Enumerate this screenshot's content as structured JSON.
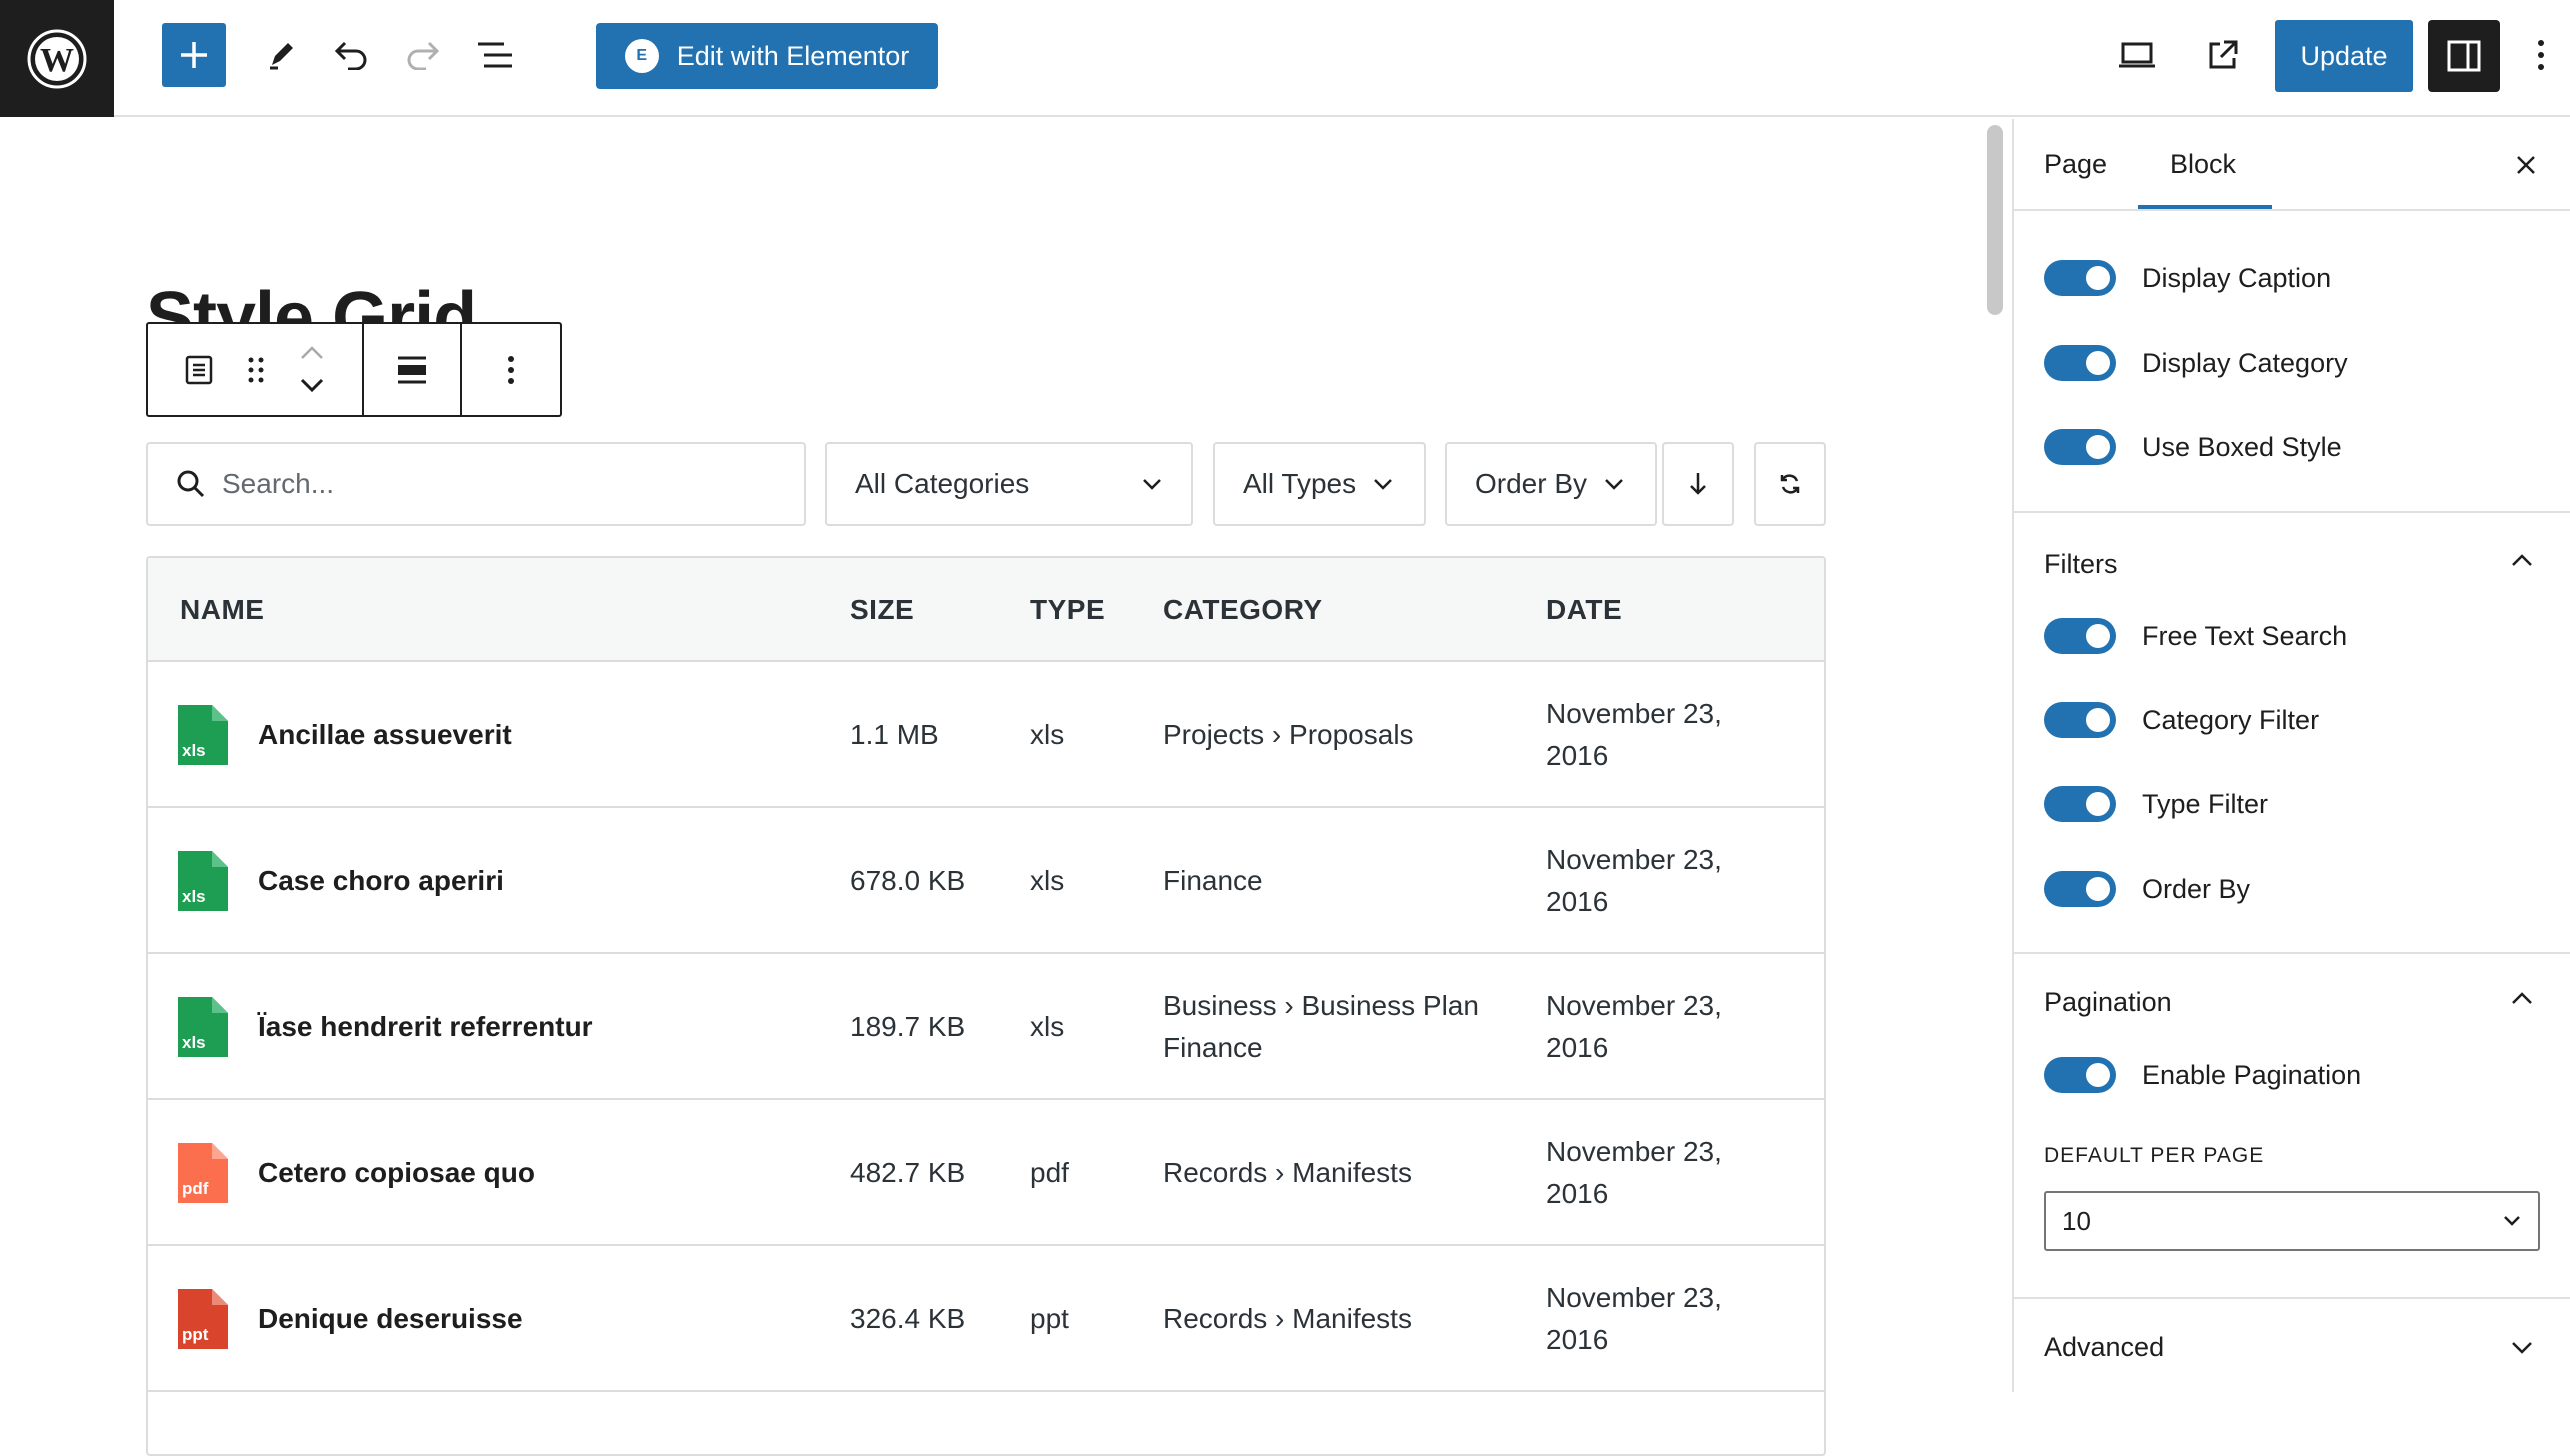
{
  "topbar": {
    "edit_elementor_label": "Edit with Elementor",
    "update_label": "Update"
  },
  "page": {
    "title": "Style Grid"
  },
  "filters": {
    "search_placeholder": "Search...",
    "category": "All Categories",
    "type": "All Types",
    "order": "Order By"
  },
  "table": {
    "headers": [
      "NAME",
      "SIZE",
      "TYPE",
      "CATEGORY",
      "DATE"
    ],
    "rows": [
      {
        "name": "Ancillae assueverit",
        "size": "1.1 MB",
        "type": "xls",
        "category": "Projects › Proposals",
        "category2": "",
        "date": "November 23,",
        "date2": "2016",
        "icon_label": "xls",
        "icon_color": "#1e9e53"
      },
      {
        "name": "Case choro aperiri",
        "size": "678.0 KB",
        "type": "xls",
        "category": "Finance",
        "category2": "",
        "date": "November 23,",
        "date2": "2016",
        "icon_label": "xls",
        "icon_color": "#1e9e53"
      },
      {
        "name": "Ïase hendrerit referrentur",
        "size": "189.7 KB",
        "type": "xls",
        "category": "Business › Business Plan",
        "category2": "Finance",
        "date": "November 23,",
        "date2": "2016",
        "icon_label": "xls",
        "icon_color": "#1e9e53"
      },
      {
        "name": "Cetero copiosae quo",
        "size": "482.7 KB",
        "type": "pdf",
        "category": "Records › Manifests",
        "category2": "",
        "date": "November 23,",
        "date2": "2016",
        "icon_label": "pdf",
        "icon_color": "#fb6f4f"
      },
      {
        "name": "Denique deseruisse",
        "size": "326.4 KB",
        "type": "ppt",
        "category": "Records › Manifests",
        "category2": "",
        "date": "November 23,",
        "date2": "2016",
        "icon_label": "ppt",
        "icon_color": "#d9452c"
      }
    ]
  },
  "sidebar": {
    "tab_page": "Page",
    "tab_block": "Block",
    "display_toggles": [
      "Display Caption",
      "Display Category",
      "Use Boxed Style"
    ],
    "filters_title": "Filters",
    "filter_toggles": [
      "Free Text Search",
      "Category Filter",
      "Type Filter",
      "Order By"
    ],
    "pagination_title": "Pagination",
    "pagination_toggle": "Enable Pagination",
    "per_page_label": "DEFAULT PER PAGE",
    "per_page_value": "10",
    "advanced_title": "Advanced"
  },
  "colors": {
    "accent": "#2271b1",
    "dark": "#1e1e1e"
  }
}
